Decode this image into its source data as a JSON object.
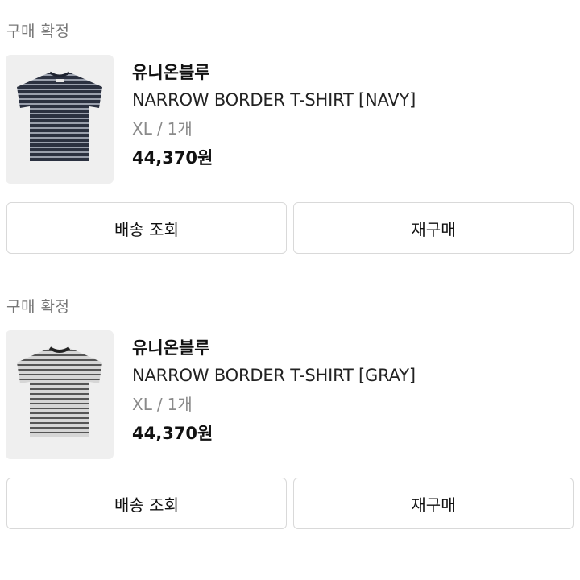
{
  "orders": [
    {
      "status": "구매 확정",
      "brand": "유니온블루",
      "product_name": "NARROW BORDER T-SHIRT [NAVY]",
      "size": "XL",
      "option_sep": "/",
      "quantity": "1개",
      "price": "44,370원",
      "tshirt_color": "#2b3140",
      "stripe_color": "#9aa0ad",
      "buttons": {
        "tracking": "배송 조회",
        "rebuy": "재구매"
      }
    },
    {
      "status": "구매 확정",
      "brand": "유니온블루",
      "product_name": "NARROW BORDER T-SHIRT [GRAY]",
      "size": "XL",
      "option_sep": "/",
      "quantity": "1개",
      "price": "44,370원",
      "tshirt_color": "#6b6b6b",
      "stripe_color": "#d6d6d6",
      "buttons": {
        "tracking": "배송 조회",
        "rebuy": "재구매"
      }
    }
  ]
}
